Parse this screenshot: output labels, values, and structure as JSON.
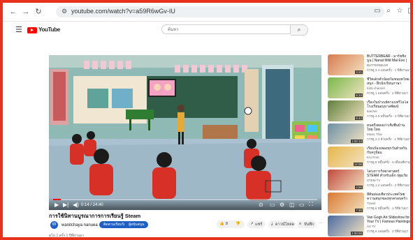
{
  "browser": {
    "url": "youtube.com/watch?v=a59R6wGv-IU"
  },
  "youtube": {
    "logo_text": "YouTube",
    "search_placeholder": "ค้นหา"
  },
  "video": {
    "time": "0:14 / 24:40",
    "progress": 0.03,
    "title": "การใช้นิทานบูรณาการการเรียนรู้ Steam",
    "channel": "wanitchaya nanuea",
    "subscribe_label": "ติดตามเรียบร้อย",
    "join_label": "ผู้สนับสนุน",
    "like_count": "8",
    "share_label": "แชร์",
    "download_label": "ดาวน์โหลด",
    "save_label": "บันทึก",
    "description": "ดูไม่ 1 ครั้ง 1 ปีที่ผ่านมา"
  },
  "recommendations": [
    {
      "title": "BUTTERBEAR - มาร์ชชิ่งบูน | Nanat Mild Mai Eoo | Official...",
      "channel": "BUTTERBEAR",
      "meta": "การดู 3.4 แสนครั้ง · 1 ปีที่ผ่านมา",
      "duration": "3:21",
      "color": "#d97b4e"
    },
    {
      "title": "ชีวิตเด็กตัวน้อยในชนบทไทยสนุก - ฝึกนักเรียนภาษา",
      "channel": "Kids channel",
      "meta": "การดู 1 แสนครั้ง · 2 ปีที่ผ่านมา",
      "duration": "5:10",
      "color": "#79b849"
    },
    {
      "title": "เรื่องในป่าเบย์ตาแบทรีโอโล โรงเรียนอนุบาลพัฒน์",
      "channel": "teacher",
      "meta": "การดู 4.5 หมื่นครั้ง · 3 ปีที่ผ่านมา",
      "duration": "8:42",
      "color": "#5f7f3c"
    },
    {
      "title": "ดนตรีเพลงเก่าเชิงพื้นบ้านไทย ไทย",
      "channel": "Music Thai",
      "meta": "การดู 2.3 ล้านครั้ง · 1 ปีที่ผ่านมา",
      "duration": "1:02:13",
      "color": "#6b8fa6"
    },
    {
      "title": "เรียนร้องเพลงทุกวันด้วยกัน กับครูป้อม",
      "channel": "Kru Pom",
      "meta": "การดู 8 หมื่นครั้ง · 5 เดือนที่ผ่านมา",
      "duration": "12:05",
      "color": "#e6b54a"
    },
    {
      "title": "โครงการวิทยาศาสตร์ STEAM สำหรับเด็ก ปฐมวัย ตอนที่ 3",
      "channel": "STEM TV",
      "meta": "การดู 1.2 แสนครั้ง · 2 ปีที่ผ่านมา",
      "duration": "4:55",
      "color": "#c04a3c"
    },
    {
      "title": "สีสันท่องเที่ยวประเทศไทย ความสนุกของทุกครอบครัว",
      "channel": "Travel",
      "meta": "การดู 6 หมื่นครั้ง · 1 ปีที่ผ่านมา",
      "duration": "7:30",
      "color": "#d9782f"
    },
    {
      "title": "Van Gogh Art Slideshow for Your TV | Famous Paintings",
      "channel": "Art TV",
      "meta": "การดู 9 แสนครั้ง · 3 ปีที่ผ่านมา",
      "duration": "2:00:00",
      "color": "#4a6aa0"
    }
  ]
}
